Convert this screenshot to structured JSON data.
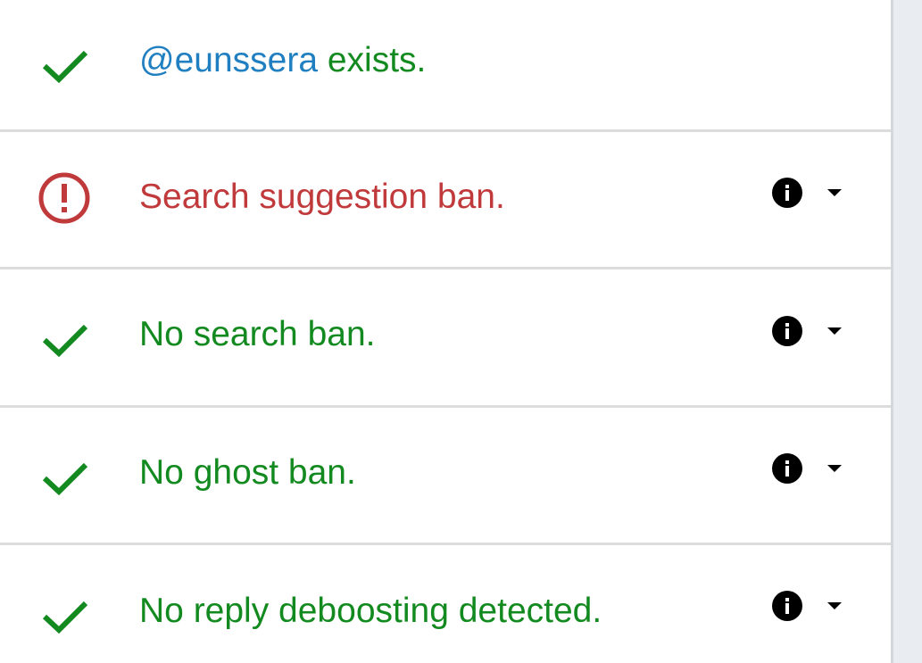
{
  "colors": {
    "pass": "#138a1f",
    "fail": "#c0393b",
    "handle": "#1f7fc0",
    "divider": "#dcdcdc"
  },
  "results": [
    {
      "status": "pass",
      "icon": "check-icon",
      "handle": "@eunssera",
      "text": " exists.",
      "has_info": false
    },
    {
      "status": "fail",
      "icon": "alert-circle-icon",
      "text": "Search suggestion ban.",
      "has_info": true,
      "info_icon": "info-icon",
      "expand_icon": "caret-down-icon"
    },
    {
      "status": "pass",
      "icon": "check-icon",
      "text": "No search ban.",
      "has_info": true,
      "info_icon": "info-icon",
      "expand_icon": "caret-down-icon"
    },
    {
      "status": "pass",
      "icon": "check-icon",
      "text": "No ghost ban.",
      "has_info": true,
      "info_icon": "info-icon",
      "expand_icon": "caret-down-icon"
    },
    {
      "status": "pass",
      "icon": "check-icon",
      "text": "No reply deboosting detected.",
      "has_info": true,
      "info_icon": "info-icon",
      "expand_icon": "caret-down-icon"
    }
  ]
}
